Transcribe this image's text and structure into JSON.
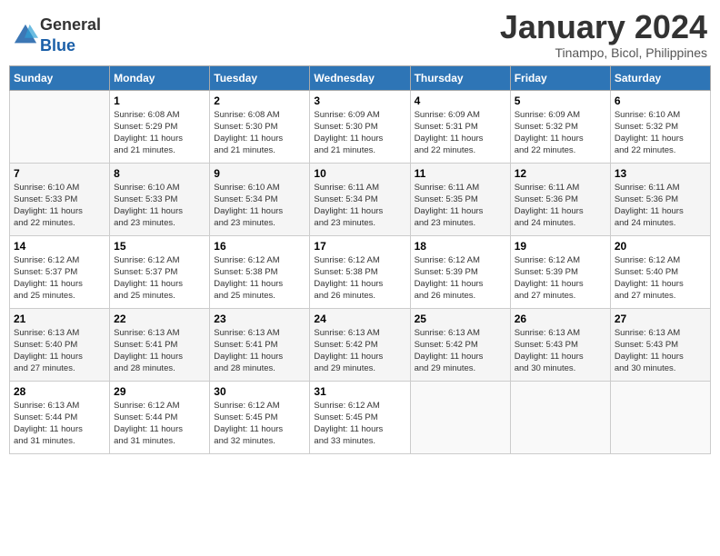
{
  "header": {
    "logo_general": "General",
    "logo_blue": "Blue",
    "month_title": "January 2024",
    "location": "Tinampo, Bicol, Philippines"
  },
  "days_of_week": [
    "Sunday",
    "Monday",
    "Tuesday",
    "Wednesday",
    "Thursday",
    "Friday",
    "Saturday"
  ],
  "weeks": [
    [
      {
        "day": "",
        "info": ""
      },
      {
        "day": "1",
        "info": "Sunrise: 6:08 AM\nSunset: 5:29 PM\nDaylight: 11 hours\nand 21 minutes."
      },
      {
        "day": "2",
        "info": "Sunrise: 6:08 AM\nSunset: 5:30 PM\nDaylight: 11 hours\nand 21 minutes."
      },
      {
        "day": "3",
        "info": "Sunrise: 6:09 AM\nSunset: 5:30 PM\nDaylight: 11 hours\nand 21 minutes."
      },
      {
        "day": "4",
        "info": "Sunrise: 6:09 AM\nSunset: 5:31 PM\nDaylight: 11 hours\nand 22 minutes."
      },
      {
        "day": "5",
        "info": "Sunrise: 6:09 AM\nSunset: 5:32 PM\nDaylight: 11 hours\nand 22 minutes."
      },
      {
        "day": "6",
        "info": "Sunrise: 6:10 AM\nSunset: 5:32 PM\nDaylight: 11 hours\nand 22 minutes."
      }
    ],
    [
      {
        "day": "7",
        "info": "Sunrise: 6:10 AM\nSunset: 5:33 PM\nDaylight: 11 hours\nand 22 minutes."
      },
      {
        "day": "8",
        "info": "Sunrise: 6:10 AM\nSunset: 5:33 PM\nDaylight: 11 hours\nand 23 minutes."
      },
      {
        "day": "9",
        "info": "Sunrise: 6:10 AM\nSunset: 5:34 PM\nDaylight: 11 hours\nand 23 minutes."
      },
      {
        "day": "10",
        "info": "Sunrise: 6:11 AM\nSunset: 5:34 PM\nDaylight: 11 hours\nand 23 minutes."
      },
      {
        "day": "11",
        "info": "Sunrise: 6:11 AM\nSunset: 5:35 PM\nDaylight: 11 hours\nand 23 minutes."
      },
      {
        "day": "12",
        "info": "Sunrise: 6:11 AM\nSunset: 5:36 PM\nDaylight: 11 hours\nand 24 minutes."
      },
      {
        "day": "13",
        "info": "Sunrise: 6:11 AM\nSunset: 5:36 PM\nDaylight: 11 hours\nand 24 minutes."
      }
    ],
    [
      {
        "day": "14",
        "info": "Sunrise: 6:12 AM\nSunset: 5:37 PM\nDaylight: 11 hours\nand 25 minutes."
      },
      {
        "day": "15",
        "info": "Sunrise: 6:12 AM\nSunset: 5:37 PM\nDaylight: 11 hours\nand 25 minutes."
      },
      {
        "day": "16",
        "info": "Sunrise: 6:12 AM\nSunset: 5:38 PM\nDaylight: 11 hours\nand 25 minutes."
      },
      {
        "day": "17",
        "info": "Sunrise: 6:12 AM\nSunset: 5:38 PM\nDaylight: 11 hours\nand 26 minutes."
      },
      {
        "day": "18",
        "info": "Sunrise: 6:12 AM\nSunset: 5:39 PM\nDaylight: 11 hours\nand 26 minutes."
      },
      {
        "day": "19",
        "info": "Sunrise: 6:12 AM\nSunset: 5:39 PM\nDaylight: 11 hours\nand 27 minutes."
      },
      {
        "day": "20",
        "info": "Sunrise: 6:12 AM\nSunset: 5:40 PM\nDaylight: 11 hours\nand 27 minutes."
      }
    ],
    [
      {
        "day": "21",
        "info": "Sunrise: 6:13 AM\nSunset: 5:40 PM\nDaylight: 11 hours\nand 27 minutes."
      },
      {
        "day": "22",
        "info": "Sunrise: 6:13 AM\nSunset: 5:41 PM\nDaylight: 11 hours\nand 28 minutes."
      },
      {
        "day": "23",
        "info": "Sunrise: 6:13 AM\nSunset: 5:41 PM\nDaylight: 11 hours\nand 28 minutes."
      },
      {
        "day": "24",
        "info": "Sunrise: 6:13 AM\nSunset: 5:42 PM\nDaylight: 11 hours\nand 29 minutes."
      },
      {
        "day": "25",
        "info": "Sunrise: 6:13 AM\nSunset: 5:42 PM\nDaylight: 11 hours\nand 29 minutes."
      },
      {
        "day": "26",
        "info": "Sunrise: 6:13 AM\nSunset: 5:43 PM\nDaylight: 11 hours\nand 30 minutes."
      },
      {
        "day": "27",
        "info": "Sunrise: 6:13 AM\nSunset: 5:43 PM\nDaylight: 11 hours\nand 30 minutes."
      }
    ],
    [
      {
        "day": "28",
        "info": "Sunrise: 6:13 AM\nSunset: 5:44 PM\nDaylight: 11 hours\nand 31 minutes."
      },
      {
        "day": "29",
        "info": "Sunrise: 6:12 AM\nSunset: 5:44 PM\nDaylight: 11 hours\nand 31 minutes."
      },
      {
        "day": "30",
        "info": "Sunrise: 6:12 AM\nSunset: 5:45 PM\nDaylight: 11 hours\nand 32 minutes."
      },
      {
        "day": "31",
        "info": "Sunrise: 6:12 AM\nSunset: 5:45 PM\nDaylight: 11 hours\nand 33 minutes."
      },
      {
        "day": "",
        "info": ""
      },
      {
        "day": "",
        "info": ""
      },
      {
        "day": "",
        "info": ""
      }
    ]
  ]
}
